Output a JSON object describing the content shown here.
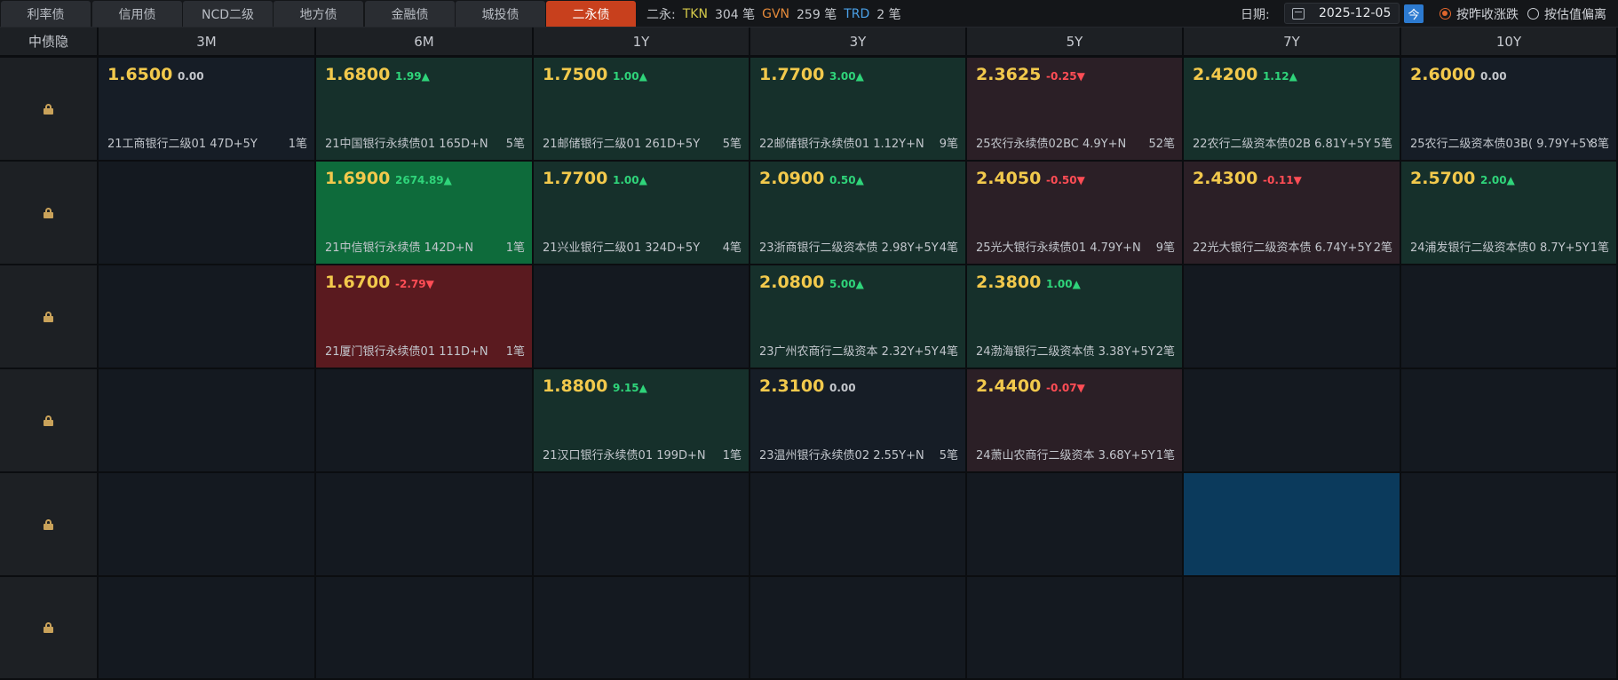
{
  "tabs": [
    {
      "label": "利率债",
      "active": false
    },
    {
      "label": "信用债",
      "active": false
    },
    {
      "label": "NCD二级",
      "active": false
    },
    {
      "label": "地方债",
      "active": false
    },
    {
      "label": "金融债",
      "active": false
    },
    {
      "label": "城投债",
      "active": false
    },
    {
      "label": "二永债",
      "active": true
    }
  ],
  "summary": {
    "prefix": "二永:",
    "tkn_label": "TKN",
    "tkn_value": "304 笔",
    "gvn_label": "GVN",
    "gvn_value": "259 笔",
    "trd_label": "TRD",
    "trd_value": "2 笔"
  },
  "date": {
    "label": "日期:",
    "value": "2025-12-05",
    "today": "今"
  },
  "radios": [
    {
      "label": "按昨收涨跌",
      "selected": true
    },
    {
      "label": "按估值偏离",
      "selected": false
    }
  ],
  "grid": {
    "corner": "中债隐",
    "columns": [
      "3M",
      "6M",
      "1Y",
      "3Y",
      "5Y",
      "7Y",
      "10Y"
    ],
    "rows": [
      [
        {
          "yield": "1.6500",
          "change": "0.00",
          "dir": "flat",
          "name": "21工商银行二级01 47D+5Y",
          "count": "1笔",
          "tone": "n"
        },
        {
          "yield": "1.6800",
          "change": "1.99▲",
          "dir": "up",
          "name": "21中国银行永续债01 165D+N",
          "count": "5笔",
          "tone": "g"
        },
        {
          "yield": "1.7500",
          "change": "1.00▲",
          "dir": "up",
          "name": "21邮储银行二级01 261D+5Y",
          "count": "5笔",
          "tone": "g"
        },
        {
          "yield": "1.7700",
          "change": "3.00▲",
          "dir": "up",
          "name": "22邮储银行永续债01 1.12Y+N",
          "count": "9笔",
          "tone": "g"
        },
        {
          "yield": "2.3625",
          "change": "-0.25▼",
          "dir": "down",
          "name": "25农行永续债02BC 4.9Y+N",
          "count": "52笔",
          "tone": "r"
        },
        {
          "yield": "2.4200",
          "change": "1.12▲",
          "dir": "up",
          "name": "22农行二级资本债02B 6.81Y+5Y",
          "count": "5笔",
          "tone": "g"
        },
        {
          "yield": "2.6000",
          "change": "0.00",
          "dir": "flat",
          "name": "25农行二级资本债03B( 9.79Y+5Y",
          "count": "8笔",
          "tone": "n"
        }
      ],
      [
        null,
        {
          "yield": "1.6900",
          "change": "2674.89▲",
          "dir": "up",
          "name": "21中信银行永续债 142D+N",
          "count": "1笔",
          "tone": "gb"
        },
        {
          "yield": "1.7700",
          "change": "1.00▲",
          "dir": "up",
          "name": "21兴业银行二级01 324D+5Y",
          "count": "4笔",
          "tone": "g"
        },
        {
          "yield": "2.0900",
          "change": "0.50▲",
          "dir": "up",
          "name": "23浙商银行二级资本债 2.98Y+5Y",
          "count": "4笔",
          "tone": "g"
        },
        {
          "yield": "2.4050",
          "change": "-0.50▼",
          "dir": "down",
          "name": "25光大银行永续债01 4.79Y+N",
          "count": "9笔",
          "tone": "r"
        },
        {
          "yield": "2.4300",
          "change": "-0.11▼",
          "dir": "down",
          "name": "22光大银行二级资本债 6.74Y+5Y",
          "count": "2笔",
          "tone": "r"
        },
        {
          "yield": "2.5700",
          "change": "2.00▲",
          "dir": "up",
          "name": "24浦发银行二级资本债0 8.7Y+5Y",
          "count": "1笔",
          "tone": "g"
        }
      ],
      [
        null,
        {
          "yield": "1.6700",
          "change": "-2.79▼",
          "dir": "down",
          "name": "21厦门银行永续债01 111D+N",
          "count": "1笔",
          "tone": "rb"
        },
        null,
        {
          "yield": "2.0800",
          "change": "5.00▲",
          "dir": "up",
          "name": "23广州农商行二级资本 2.32Y+5Y",
          "count": "4笔",
          "tone": "g"
        },
        {
          "yield": "2.3800",
          "change": "1.00▲",
          "dir": "up",
          "name": "24渤海银行二级资本债 3.38Y+5Y",
          "count": "2笔",
          "tone": "g"
        },
        null,
        null
      ],
      [
        null,
        null,
        {
          "yield": "1.8800",
          "change": "9.15▲",
          "dir": "up",
          "name": "21汉口银行永续债01 199D+N",
          "count": "1笔",
          "tone": "g"
        },
        {
          "yield": "2.3100",
          "change": "0.00",
          "dir": "flat",
          "name": "23温州银行永续债02 2.55Y+N",
          "count": "5笔",
          "tone": "n"
        },
        {
          "yield": "2.4400",
          "change": "-0.07▼",
          "dir": "down",
          "name": "24萧山农商行二级资本 3.68Y+5Y",
          "count": "1笔",
          "tone": "r"
        },
        null,
        null
      ],
      [
        null,
        null,
        null,
        null,
        null,
        {
          "selected_empty": true
        },
        null
      ],
      [
        null,
        null,
        null,
        null,
        null,
        null,
        null
      ]
    ]
  },
  "colors": {
    "accent": "#c8401d",
    "up": "#2fd47a",
    "down": "#ff4d55",
    "yield": "#f2c94c",
    "lock": "#c9a25a"
  }
}
